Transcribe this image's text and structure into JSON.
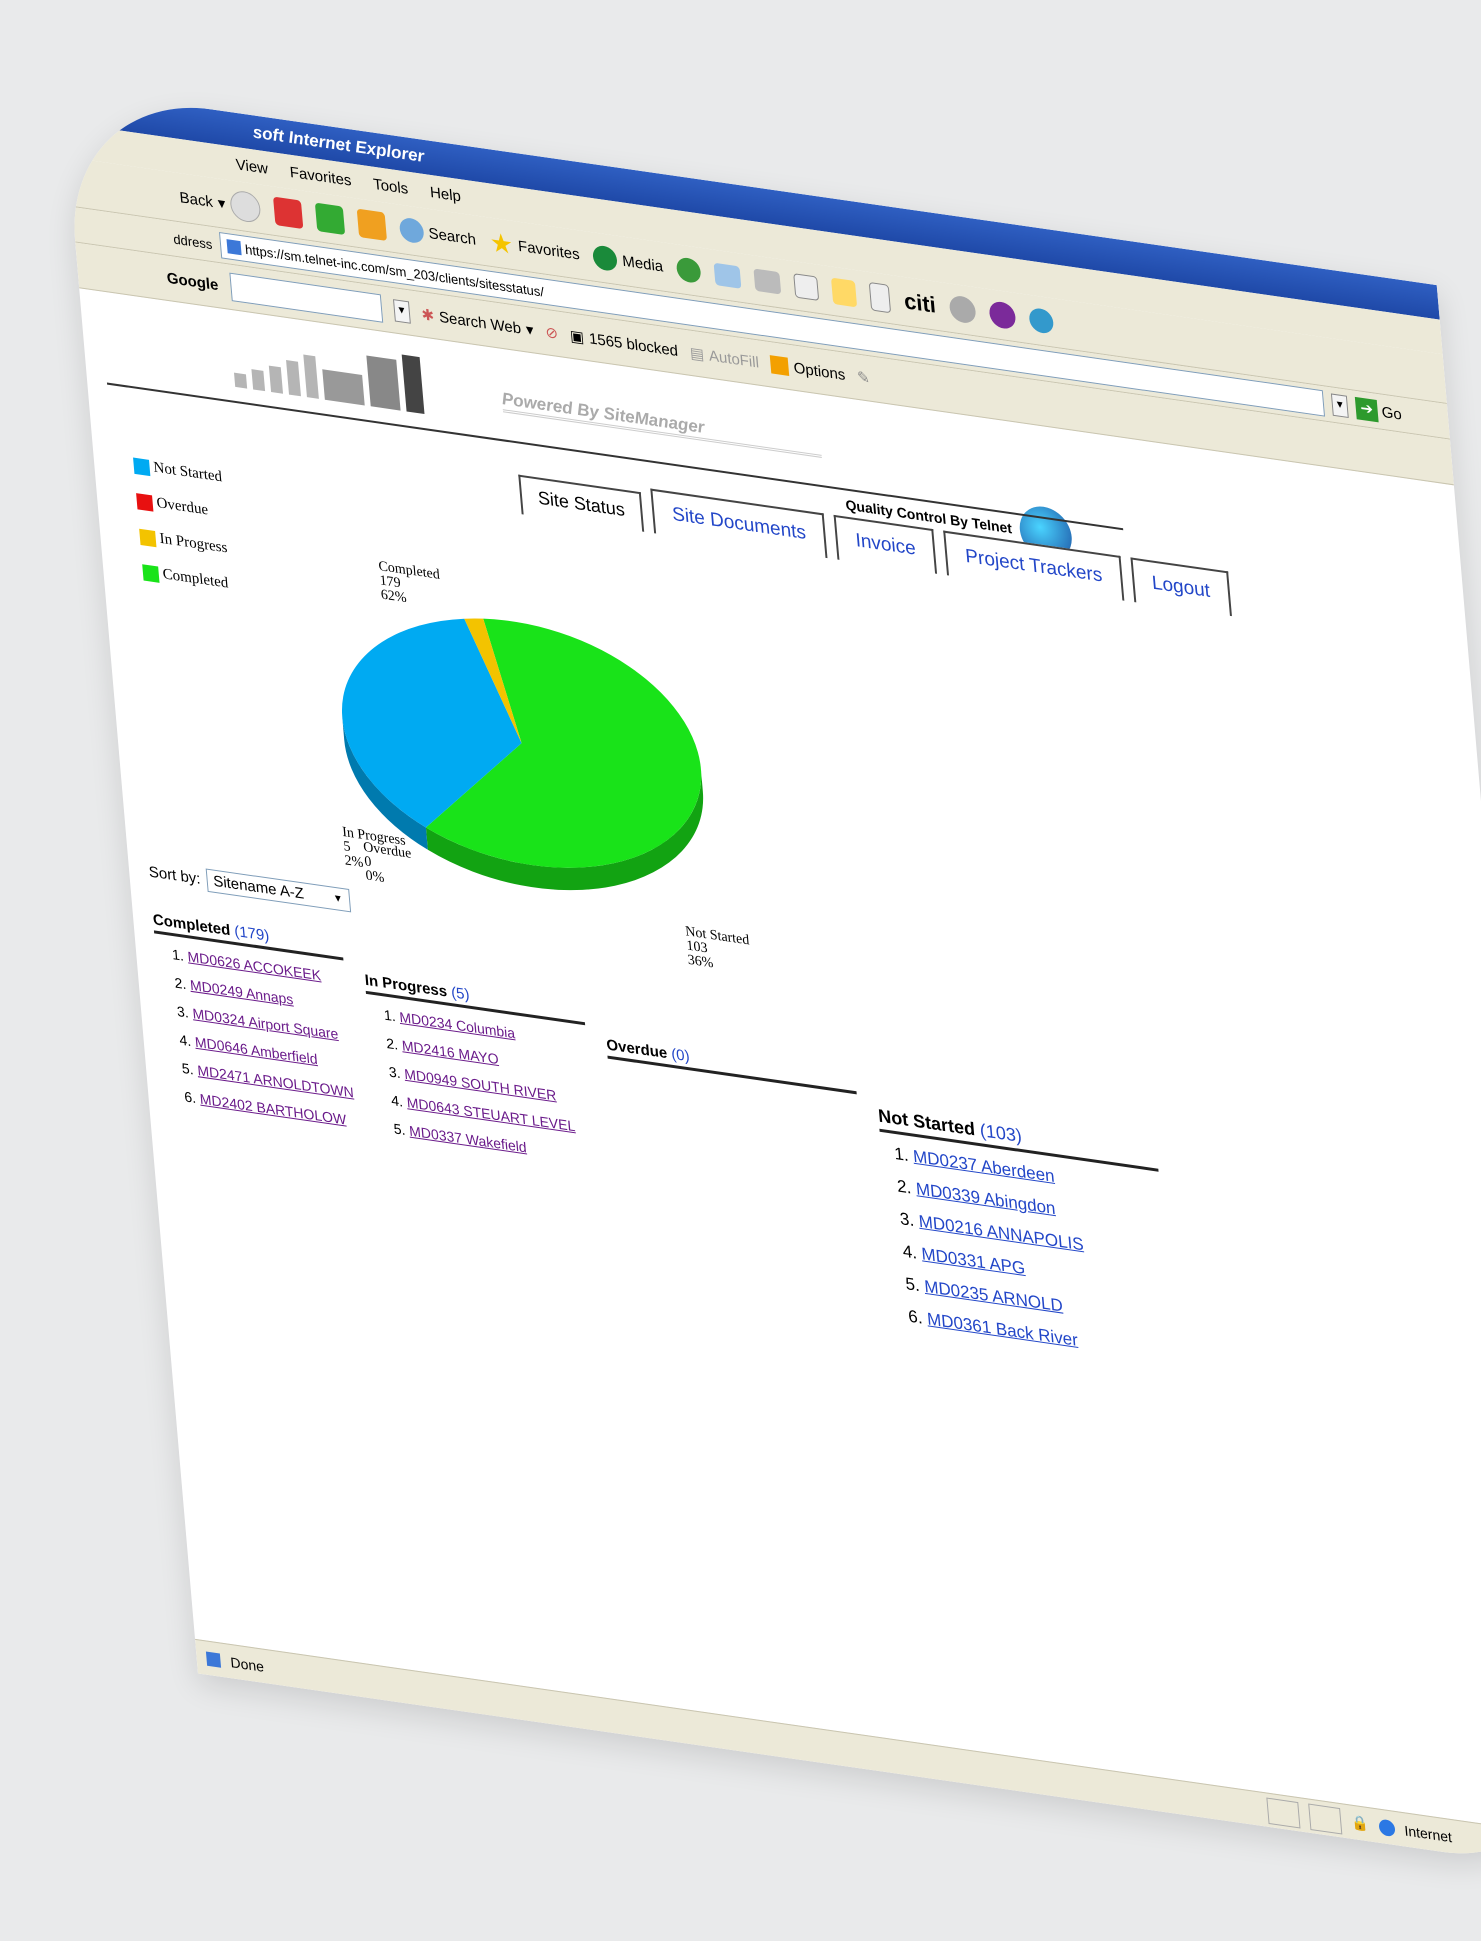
{
  "window": {
    "title": "soft Internet Explorer"
  },
  "menu": [
    "View",
    "Favorites",
    "Tools",
    "Help"
  ],
  "toolbar": {
    "back": "Back",
    "search": "Search",
    "favorites": "Favorites",
    "media": "Media"
  },
  "address": {
    "label": "ddress",
    "url": "https://sm.telnet-inc.com/sm_203/clients/sitesstatus/",
    "go": "Go"
  },
  "googlebar": {
    "label": "Google",
    "search_web": "Search Web",
    "blocked": "1565 blocked",
    "autofill": "AutoFill",
    "options": "Options"
  },
  "page": {
    "powered": "Powered By SiteManager",
    "quality": "Quality Control By Telnet",
    "tabs": [
      "Site Status",
      "Site Documents",
      "Invoice",
      "Project Trackers",
      "Logout"
    ],
    "sort_label": "Sort by:",
    "sort_value": "Sitename A-Z"
  },
  "legend": [
    {
      "label": "Not Started",
      "color": "#00aaf2"
    },
    {
      "label": "Overdue",
      "color": "#e81010"
    },
    {
      "label": "In Progress",
      "color": "#f3c300"
    },
    {
      "label": "Completed",
      "color": "#19e319"
    }
  ],
  "chart_data": {
    "type": "pie",
    "slices": [
      {
        "label": "Completed",
        "value": 179,
        "percent": "62%",
        "color": "#19e319"
      },
      {
        "label": "Not Started",
        "value": 103,
        "percent": "36%",
        "color": "#00aaf2"
      },
      {
        "label": "In Progress",
        "value": 5,
        "percent": "2%",
        "color": "#f3c300"
      },
      {
        "label": "Overdue",
        "value": 0,
        "percent": "0%",
        "color": "#e81010"
      }
    ]
  },
  "lists": {
    "completed": {
      "title": "Completed",
      "count": "(179)",
      "items": [
        "MD0626 ACCOKEEK",
        "MD0249 Annaps",
        "MD0324 Airport Square",
        "MD0646 Amberfield",
        "MD2471 ARNOLDTOWN",
        "MD2402 BARTHOLOW"
      ]
    },
    "in_progress": {
      "title": "In Progress",
      "count": "(5)",
      "items": [
        "MD0234 Columbia",
        "MD2416 MAYO",
        "MD0949 SOUTH RIVER",
        "MD0643 STEUART LEVEL",
        "MD0337 Wakefield"
      ]
    },
    "overdue": {
      "title": "Overdue",
      "count": "(0)",
      "items": []
    },
    "not_started": {
      "title": "Not Started",
      "count": "(103)",
      "items": [
        "MD0237 Aberdeen",
        "MD0339 Abingdon",
        "MD0216 ANNAPOLIS",
        "MD0331 APG",
        "MD0235 ARNOLD",
        "MD0361 Back River"
      ]
    }
  },
  "status": {
    "done": "Done",
    "zone": "Internet"
  }
}
